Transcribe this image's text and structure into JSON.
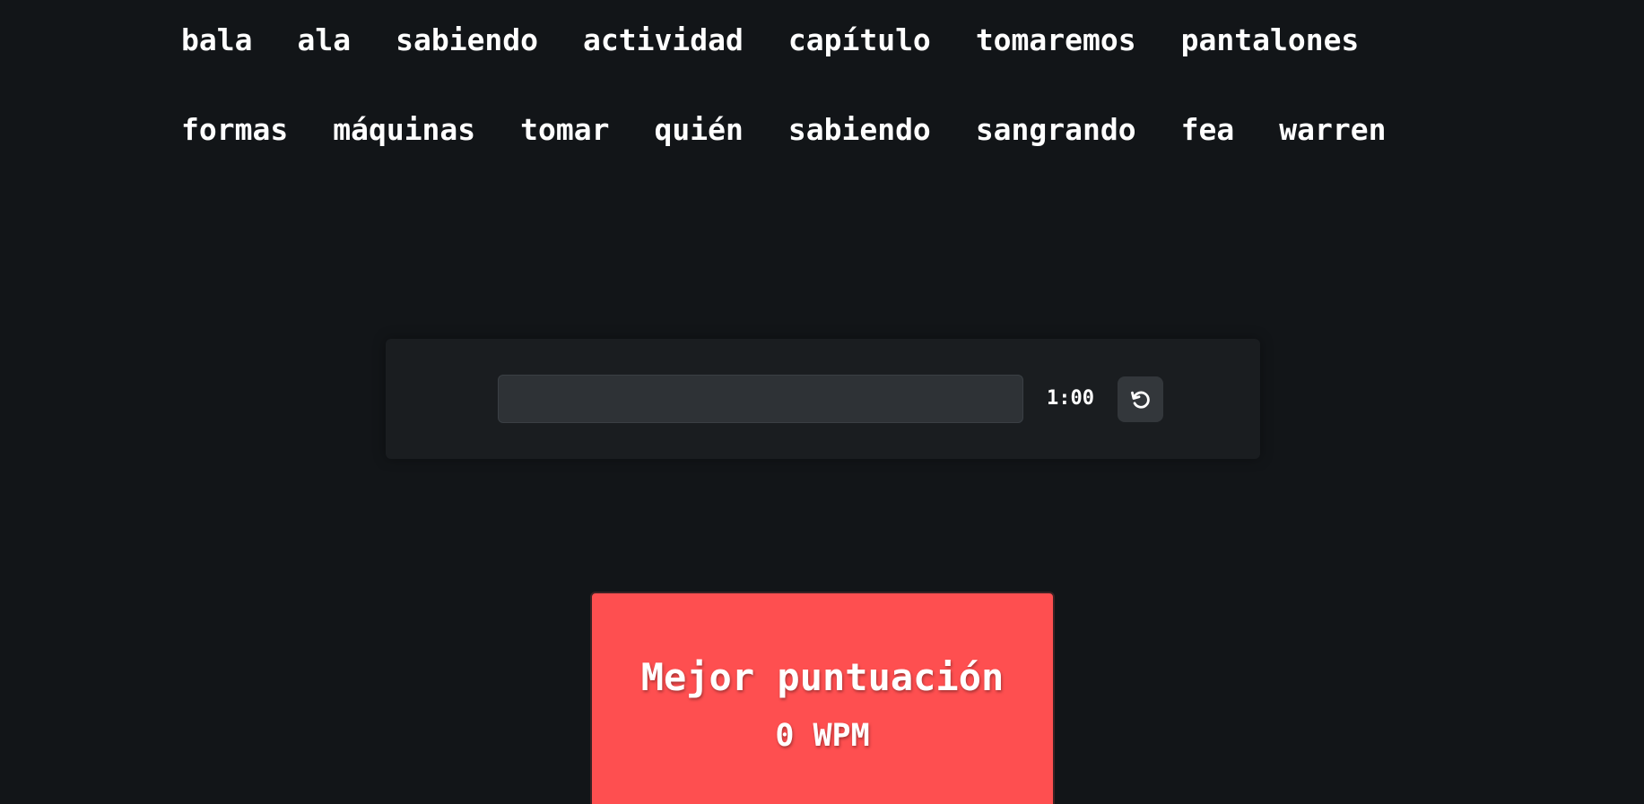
{
  "words": {
    "row1": [
      "bala",
      "ala",
      "sabiendo",
      "actividad",
      "capítulo",
      "tomaremos",
      "pantalones"
    ],
    "row2": [
      "formas",
      "máquinas",
      "tomar",
      "quién",
      "sabiendo",
      "sangrando",
      "fea",
      "warren"
    ]
  },
  "controls": {
    "input_value": "",
    "timer": "1:00",
    "reset_icon": "reset-icon"
  },
  "score": {
    "title": "Mejor puntuación",
    "value": "0 WPM"
  },
  "colors": {
    "background": "#121518",
    "panel": "#1a1d20",
    "input": "#2e3236",
    "accent": "#fe4f50"
  }
}
